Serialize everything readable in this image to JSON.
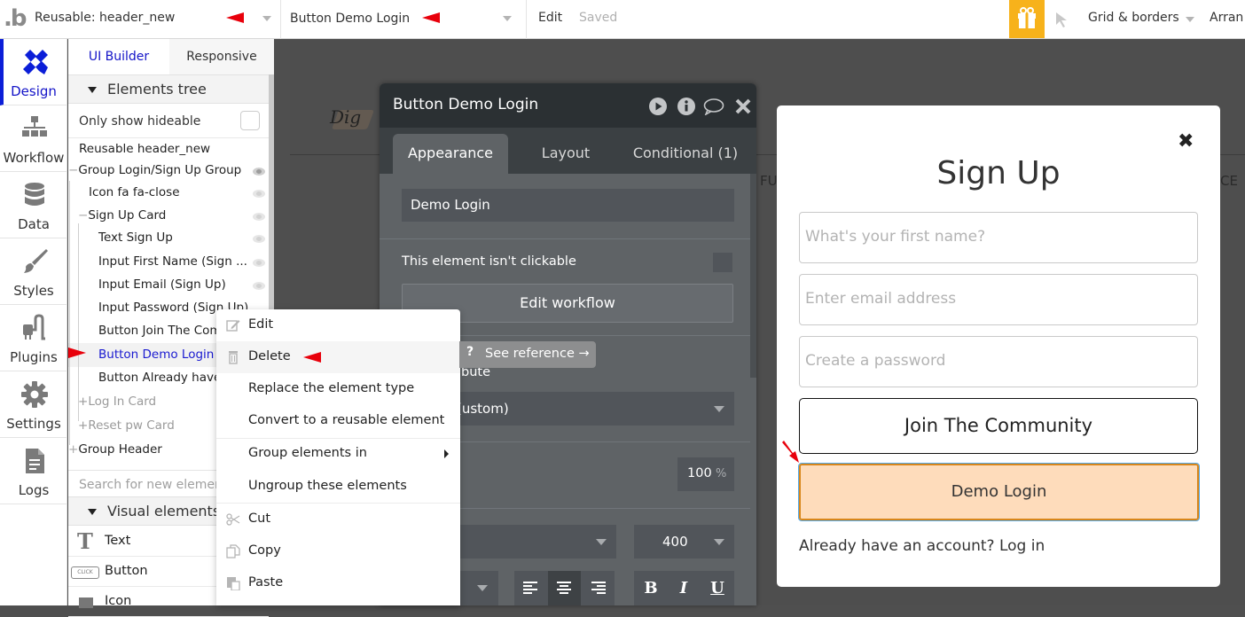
{
  "topbar": {
    "logo": ".b",
    "page_selector": "Reusable: header_new",
    "element_selector": "Button Demo Login",
    "edit_menu": "Edit",
    "save_status": "Saved",
    "grid_borders": "Grid & borders",
    "arrange": "Arran",
    "gift_color": "#f7b21b",
    "annotation_color": "#e8000b"
  },
  "leftnav": {
    "items": [
      {
        "label": "Design",
        "icon": "design-icon",
        "active": true
      },
      {
        "label": "Workflow",
        "icon": "workflow-icon"
      },
      {
        "label": "Data",
        "icon": "database-icon"
      },
      {
        "label": "Styles",
        "icon": "brush-icon"
      },
      {
        "label": "Plugins",
        "icon": "plug-icon"
      },
      {
        "label": "Settings",
        "icon": "gear-icon"
      },
      {
        "label": "Logs",
        "icon": "document-icon"
      }
    ]
  },
  "panel": {
    "tabs": [
      "UI Builder",
      "Responsive"
    ],
    "elements_tree_title": "Elements tree",
    "only_show_hideable": "Only show hideable",
    "tree": [
      {
        "label": "Reusable header_new"
      },
      {
        "label": "Group Login/Sign Up Group",
        "prefix": "−"
      },
      {
        "label": "Icon fa fa-close"
      },
      {
        "label": "Sign Up Card",
        "prefix": "−"
      },
      {
        "label": "Text Sign Up"
      },
      {
        "label": "Input First Name (Sign ..."
      },
      {
        "label": "Input Email (Sign Up)"
      },
      {
        "label": "Input Password (Sign Up)"
      },
      {
        "label": "Button Join The Community"
      },
      {
        "label": "Button Demo Login",
        "selected": true
      },
      {
        "label": "Button Already have"
      },
      {
        "label": "Log In Card",
        "prefix": "+",
        "muted": true
      },
      {
        "label": "Reset pw Card",
        "prefix": "+",
        "muted": true
      },
      {
        "label": "Group Header",
        "prefix": "+"
      }
    ],
    "search_placeholder": "Search for new elements",
    "visual_elements_title": "Visual elements",
    "visual_elements": [
      {
        "label": "Text",
        "icon": "text-t-icon"
      },
      {
        "label": "Button",
        "icon": "button-click-icon",
        "icon_text": "CLICK"
      },
      {
        "label": "Icon",
        "icon": "flag-icon"
      }
    ]
  },
  "canvas": {
    "logo_text": "Dig",
    "nav_left": "FU",
    "nav_right": "CE"
  },
  "editor": {
    "title": "Button Demo Login",
    "tabs": [
      "Appearance",
      "Layout",
      "Conditional (1)"
    ],
    "active_tab": "Appearance",
    "button_text": "Demo Login",
    "not_clickable_label": "This element isn't clickable",
    "edit_workflow": "Edit workflow",
    "attribute_label_partial": "bute",
    "style_select_partial": "(ustom)",
    "opacity_value": "100",
    "opacity_unit": "%",
    "font_weight": "400",
    "format_buttons": [
      "B",
      "I",
      "U"
    ]
  },
  "context_menu": {
    "items": [
      {
        "label": "Edit",
        "icon": "pencil-icon"
      },
      {
        "label": "Delete",
        "icon": "trash-icon",
        "hover": true
      },
      {
        "label": "Replace the element type"
      },
      {
        "label": "Convert to a reusable element"
      },
      {
        "label": "Group elements in",
        "submenu": true
      },
      {
        "label": "Ungroup these elements"
      },
      {
        "label": "Cut",
        "icon": "scissors-icon"
      },
      {
        "label": "Copy",
        "icon": "copy-icon"
      },
      {
        "label": "Paste",
        "icon": "paste-icon"
      }
    ]
  },
  "tooltip": {
    "icon": "?",
    "text": "See reference →"
  },
  "signup_modal": {
    "title": "Sign Up",
    "first_name_placeholder": "What's your first name?",
    "email_placeholder": "Enter email address",
    "password_placeholder": "Create a password",
    "join_button": "Join The Community",
    "demo_button": "Demo Login",
    "demo_button_color": "#fedcbb",
    "already_text": "Already have an account? Log in"
  }
}
